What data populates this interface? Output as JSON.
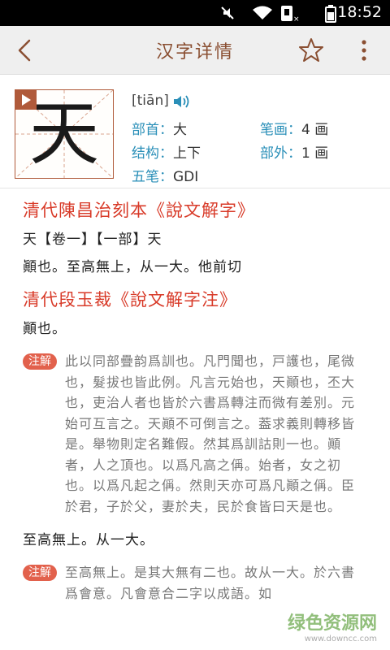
{
  "status_bar": {
    "time": "18:52",
    "icons": [
      "mute-icon",
      "wifi-icon",
      "sim-icon",
      "battery-icon"
    ]
  },
  "app_bar": {
    "title": "汉字详情",
    "back_icon": "back-chevron-icon",
    "star_icon": "star-outline-icon",
    "more_icon": "more-vertical-icon"
  },
  "character": {
    "glyph": "天",
    "pinyin": "[tiān]",
    "radical_label": "部首：",
    "radical": "大",
    "strokes_label": "笔画：",
    "strokes": "4 画",
    "structure_label": "结构：",
    "structure": "上下",
    "outside_label": "部外：",
    "outside": "1 画",
    "wubi_label": "五笔：",
    "wubi": "GDI"
  },
  "content": {
    "section1_title": "清代陳昌治刻本《說文解字》",
    "section1_line1": "天【卷一】【一部】天",
    "section1_line2": "顚也。至高無上，从一大。他前切",
    "section2_title": "清代段玉裁《說文解字注》",
    "section2_line1": "顚也。",
    "note_label": "注解",
    "note1": "此以同部疊韵爲訓也。凡門聞也，戸護也，尾微也，髮拔也皆此例。凡言元始也，天顚也，丕大也，吏治人者也皆於六書爲轉注而微有差別。元始可互言之。天顚不可倒言之。葢求義則轉移皆是。舉物則定名難假。然其爲訓詁則一也。顚者，人之頂也。以爲凡高之偁。始者，女之初也。以爲凡起之偁。然則天亦可爲凡顚之偁。臣於君，子於父，妻於夫，民於食皆曰天是也。",
    "section2_line2": "至高無上。从一大。",
    "note2": "至高無上。是其大無有二也。故从一大。於六書爲會意。凡會意合二字以成語。如"
  },
  "watermark": {
    "line1": "绿色资源网",
    "line2": "www.downcc.com"
  }
}
